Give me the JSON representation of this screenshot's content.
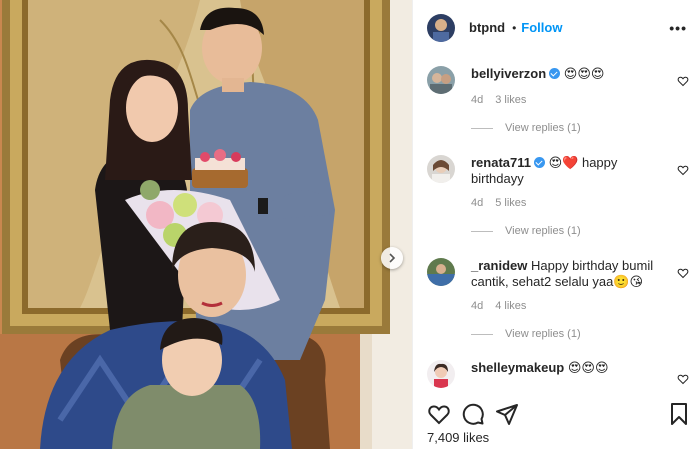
{
  "post": {
    "username": "btpnd",
    "follow_label": "Follow",
    "separator": "•",
    "more_label": "•••",
    "likes_count": "7,409",
    "likes_label": "likes"
  },
  "comments": [
    {
      "username": "bellyiverzon",
      "verified": true,
      "text": "😍😍😍",
      "time": "4d",
      "likes": "3 likes",
      "replies": "View replies (1)"
    },
    {
      "username": "renata711",
      "verified": true,
      "text": "😍❤️ happy birthdayy",
      "time": "4d",
      "likes": "5 likes",
      "replies": "View replies (1)"
    },
    {
      "username": "_ranidew",
      "verified": false,
      "text": "Happy birthday bumil cantik, sehat2 selalu yaa🙂😘",
      "time": "4d",
      "likes": "4 likes",
      "replies": "View replies (1)"
    },
    {
      "username": "shelleymakeup",
      "verified": false,
      "text": "😍😍😍",
      "time": "",
      "likes": "",
      "replies": ""
    }
  ],
  "icons": {
    "like": "heart-icon",
    "comment": "comment-icon",
    "share": "share-icon",
    "save": "bookmark-icon",
    "carousel": "chevron-right-icon"
  },
  "colors": {
    "link": "#0095f6",
    "text": "#262626",
    "muted": "#8e8e8e",
    "verified": "#3897f0"
  }
}
